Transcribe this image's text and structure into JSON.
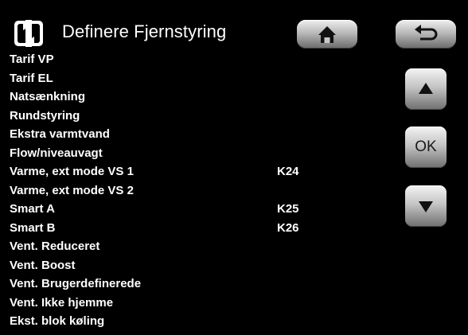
{
  "header": {
    "title": "Definere Fjernstyring",
    "icon": "remote-arrows-icon",
    "home_icon": "home-icon",
    "back_icon": "back-arrow-icon"
  },
  "nav": {
    "up_icon": "up-arrow-icon",
    "ok_label": "OK",
    "down_icon": "down-arrow-icon"
  },
  "items": [
    {
      "label": "Tarif VP",
      "value": ""
    },
    {
      "label": "Tarif EL",
      "value": ""
    },
    {
      "label": "Natsænkning",
      "value": ""
    },
    {
      "label": "Rundstyring",
      "value": ""
    },
    {
      "label": "Ekstra varmtvand",
      "value": ""
    },
    {
      "label": "Flow/niveauvagt",
      "value": ""
    },
    {
      "label": "Varme, ext mode VS 1",
      "value": "K24"
    },
    {
      "label": "Varme, ext mode VS 2",
      "value": ""
    },
    {
      "label": "Smart A",
      "value": "K25"
    },
    {
      "label": "Smart B",
      "value": "K26"
    },
    {
      "label": "Vent. Reduceret",
      "value": ""
    },
    {
      "label": "Vent. Boost",
      "value": ""
    },
    {
      "label": "Vent. Brugerdefinerede",
      "value": ""
    },
    {
      "label": "Vent. Ikke hjemme",
      "value": ""
    },
    {
      "label": "Ekst. blok køling",
      "value": ""
    }
  ],
  "colors": {
    "background": "#000000",
    "text": "#ffffff",
    "button_light": "#f0f0f0",
    "button_dark": "#6a6a6a",
    "glyph": "#1a1a1a"
  }
}
